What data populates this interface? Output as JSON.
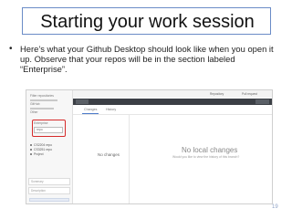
{
  "slide": {
    "title": "Starting your work session",
    "bullet_symbol": "•",
    "bullet_text": "Here’s what your Github Desktop should look like when you open it up.  Observe that your repos will be in the section labeled “Enterprise”.",
    "page_number": "19"
  },
  "screenshot": {
    "sidebar_items": [
      "Filter repositories",
      "GitHub",
      "Other",
      "Enterprise",
      "repo",
      "Another repo",
      "CS2204 repo",
      "Project"
    ],
    "repo_list": [
      "CS2204 repo",
      "CS3251 repo",
      "Project"
    ],
    "topbar_labels": [
      "Repository",
      "Pull request"
    ],
    "tabs": [
      "Changes",
      "History"
    ],
    "no_changes_small": "No changes",
    "no_local_changes": "No local changes",
    "no_local_changes_sub": "Would you like to view the history of this branch?",
    "summary_placeholder": "Summary",
    "description_placeholder": "Description"
  },
  "colors": {
    "title_border": "#6b8cc7",
    "highlight_border": "#d62b2b",
    "page_number": "#8fa3c7"
  }
}
